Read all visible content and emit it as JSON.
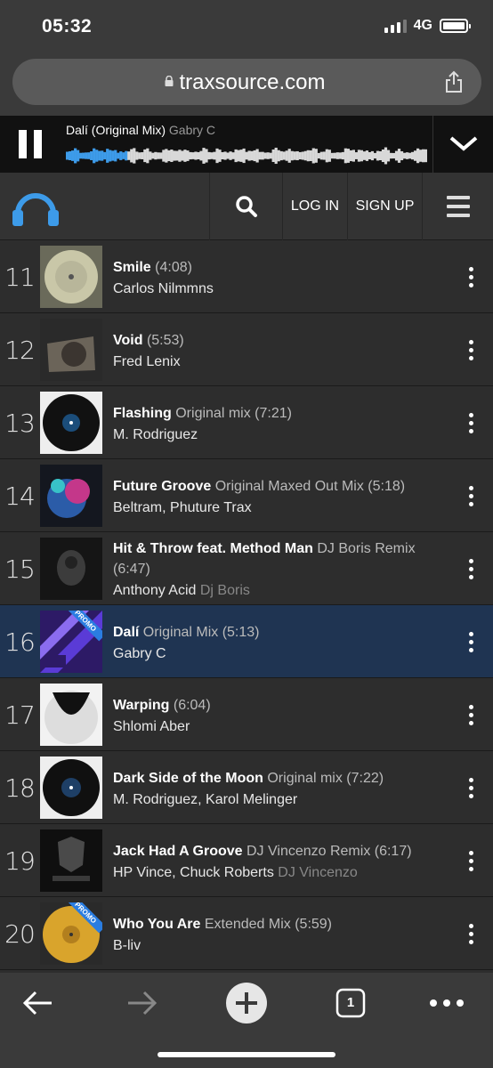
{
  "status_bar": {
    "time": "05:32",
    "network": "4G"
  },
  "browser": {
    "url": "traxsource.com",
    "tab_count": "1"
  },
  "player": {
    "track_title": "Dalí (Original Mix)",
    "track_artist": "Gabry C",
    "progress": 0.17
  },
  "nav": {
    "login_label": "LOG IN",
    "signup_label": "SIGN UP"
  },
  "tracks": [
    {
      "rank": "11",
      "title": "Smile",
      "version": "(4:08)",
      "artists": "Carlos Nilmmns",
      "remixer": "",
      "promo": false
    },
    {
      "rank": "12",
      "title": "Void",
      "version": "(5:53)",
      "artists": "Fred Lenix",
      "remixer": "",
      "promo": false
    },
    {
      "rank": "13",
      "title": "Flashing",
      "version": "Original mix (7:21)",
      "artists": "M. Rodriguez",
      "remixer": "",
      "promo": false
    },
    {
      "rank": "14",
      "title": "Future Groove",
      "version": "Original Maxed Out Mix (5:18)",
      "artists": "Beltram, Phuture Trax",
      "remixer": "",
      "promo": false
    },
    {
      "rank": "15",
      "title": "Hit & Throw feat. Method Man",
      "version": "DJ Boris Remix (6:47)",
      "artists": "Anthony Acid",
      "remixer": "Dj Boris",
      "promo": false
    },
    {
      "rank": "16",
      "title": "Dalí",
      "version": "Original Mix (5:13)",
      "artists": "Gabry C",
      "remixer": "",
      "promo": true
    },
    {
      "rank": "17",
      "title": "Warping",
      "version": "(6:04)",
      "artists": "Shlomi Aber",
      "remixer": "",
      "promo": false
    },
    {
      "rank": "18",
      "title": "Dark Side of the Moon",
      "version": "Original mix (7:22)",
      "artists": "M. Rodriguez, Karol Melinger",
      "remixer": "",
      "promo": false
    },
    {
      "rank": "19",
      "title": "Jack Had A Groove",
      "version": "DJ Vincenzo Remix (6:17)",
      "artists": "HP Vince, Chuck Roberts",
      "remixer": "DJ Vincenzo",
      "promo": false
    },
    {
      "rank": "20",
      "title": "Who You Are",
      "version": "Extended Mix (5:59)",
      "artists": "B-liv",
      "remixer": "",
      "promo": true
    }
  ],
  "promo_badge": "PROMO",
  "colors": {
    "accent": "#3d9be9",
    "active_row": "#1f3452",
    "promo": "#2a7de1"
  },
  "icons": [
    "lock-icon",
    "share-icon",
    "pause-icon",
    "chevron-down-icon",
    "headphones-logo-icon",
    "search-icon",
    "hamburger-menu-icon",
    "more-vertical-icon",
    "back-arrow-icon",
    "forward-arrow-icon",
    "new-tab-plus-icon",
    "tabs-icon",
    "more-horizontal-icon"
  ]
}
